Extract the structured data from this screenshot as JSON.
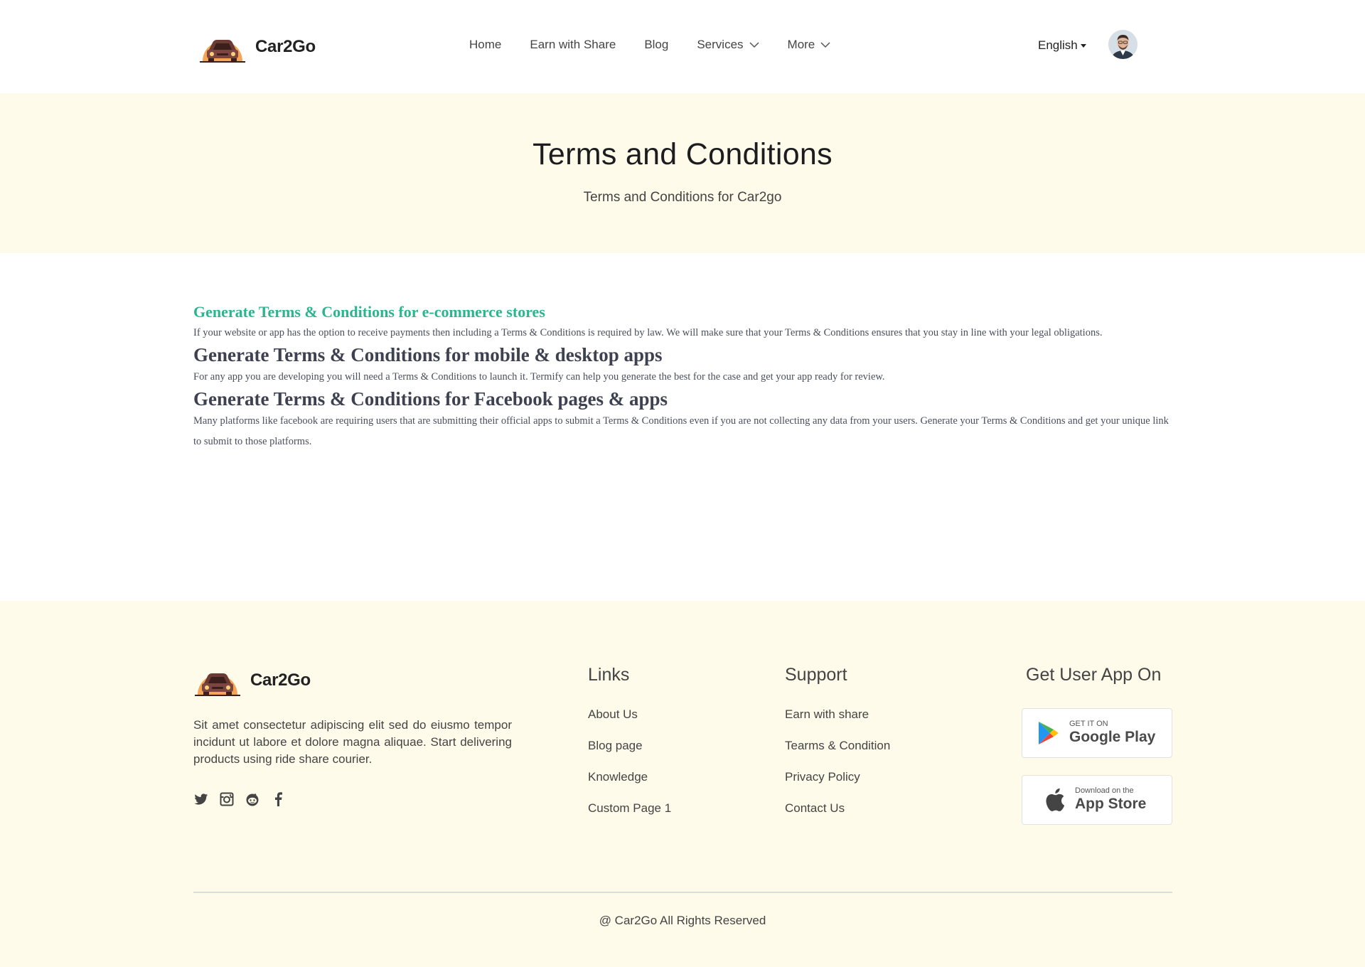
{
  "header": {
    "brand": "Car2Go",
    "nav": [
      {
        "label": "Home",
        "dropdown": false
      },
      {
        "label": "Earn with Share",
        "dropdown": false
      },
      {
        "label": "Blog",
        "dropdown": false
      },
      {
        "label": "Services",
        "dropdown": true
      },
      {
        "label": "More",
        "dropdown": true
      }
    ],
    "language": "English"
  },
  "hero": {
    "title": "Terms and Conditions",
    "subtitle": "Terms and Conditions for Car2go"
  },
  "content": {
    "sections": [
      {
        "heading": "Generate Terms & Conditions for e-commerce stores",
        "body": "If your website or app has the option to receive payments then including a Terms & Conditions is required by law. We will make sure that your Terms & Conditions ensures that you stay in line with your legal obligations."
      },
      {
        "heading": "Generate Terms & Conditions for mobile & desktop apps",
        "body": "For any app you are developing you will need a Terms & Conditions to launch it. Termify can help you generate the best for the case and get your app ready for review."
      },
      {
        "heading": "Generate Terms & Conditions for Facebook pages & apps",
        "body": "Many platforms like facebook are requiring users that are submitting their official apps to submit a Terms & Conditions even if you are not collecting any data from your users. Generate your Terms & Conditions and get your unique link to submit to those platforms."
      }
    ]
  },
  "footer": {
    "brand": "Car2Go",
    "description": "Sit amet consectetur adipiscing elit sed do eiusmo tempor incidunt ut labore et dolore magna aliquae. Start delivering products using ride share courier.",
    "socials": [
      "twitter-icon",
      "instagram-icon",
      "reddit-icon",
      "facebook-icon"
    ],
    "links": {
      "title": "Links",
      "items": [
        "About Us",
        "Blog page",
        "Knowledge",
        "Custom Page 1"
      ]
    },
    "support": {
      "title": "Support",
      "items": [
        "Earn with share",
        "Tearms & Condition",
        "Privacy Policy",
        "Contact Us"
      ]
    },
    "apps": {
      "title": "Get User App On",
      "google_small": "GET IT ON",
      "google_big": "Google Play",
      "apple_small": "Download on the",
      "apple_big": "App Store"
    },
    "copyright": "@ Car2Go All Rights Reserved"
  },
  "colors": {
    "accent_green": "#2bb58f",
    "cream": "#fefbea",
    "logo_orange": "#f5a556",
    "car_brown": "#6b3a34"
  }
}
